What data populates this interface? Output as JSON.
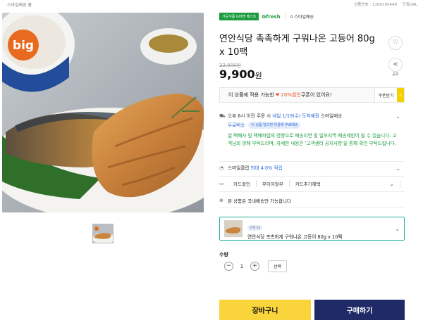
{
  "breadcrumb": "스마일배송 홈",
  "meta": {
    "product_no": "상품번호 : 2100195448",
    "report": "단축URL"
  },
  "badges": {
    "tag": "가공식품 G마켓 베스트",
    "brand": "Gfresh",
    "delivery": "스마일배송"
  },
  "product": {
    "title": "연안식당 촉촉하게 구워나온 고등어 80g x 10팩",
    "original_price": "22,000원",
    "price": "9,900",
    "price_unit": "원",
    "logo": "big"
  },
  "share_label": "공유",
  "coupon": {
    "text_before": "이 상품에 적용 가능한 ",
    "highlight": "20%할인",
    "text_after": " 쿠폰이 있어요!",
    "button": "쿠폰받기",
    "button_icon": "↓"
  },
  "shipping": {
    "line1_prefix": "오후 6시 이전 주문 시 ",
    "line1_date": "내일 1/19(수) 도착예정",
    "line1_suffix": " 스마일배송",
    "free": "무료배송",
    "pill": "이 상품 담으면 다음에 무료배송",
    "notice": "설 택배사 및 택배파업의 영향으로 배송지연 및 일부지역 배송제한이 될 수 있습니다. 고객님의 양해 부탁드리며, 자세한 내용은 '고객센터 공지사항'을 통해 확인 부탁드립니다."
  },
  "smile_club": {
    "label": "스마일클럽 ",
    "value": "최대 4.0% 적립"
  },
  "tabs": [
    "카드할인",
    "무이자할부",
    "카드추가혜택"
  ],
  "domestic": "본 상품은 국내배송만 가능합니다",
  "selected": {
    "badge": "선택 01",
    "name": "연안식당 촉촉하게 구워나온 고등어 80g x 10팩"
  },
  "quantity": {
    "label": "수량",
    "value": "1",
    "minus": "−",
    "plus": "+",
    "option_button": "선택"
  },
  "actions": {
    "cart": "장바구니",
    "buy": "구매하기"
  }
}
